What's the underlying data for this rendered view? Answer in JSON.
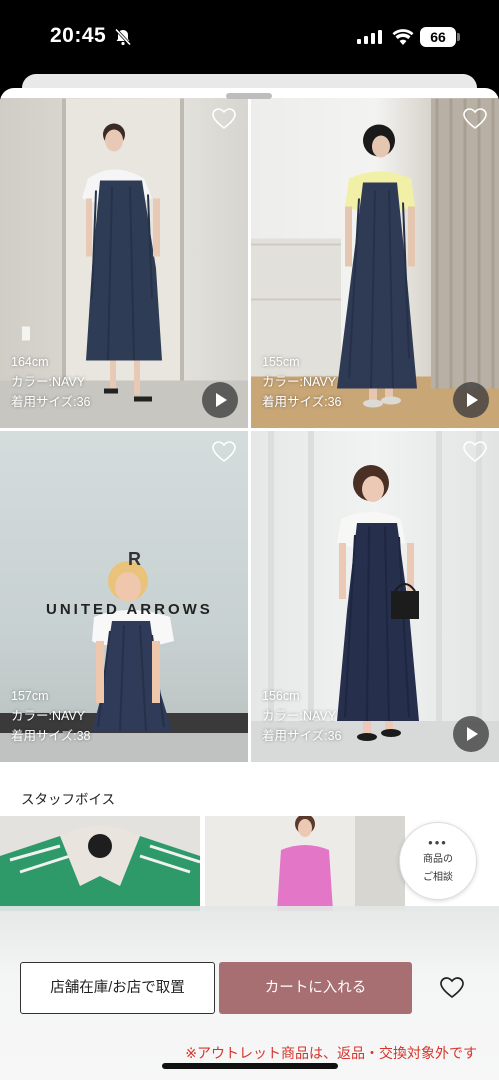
{
  "status_bar": {
    "time": "20:45",
    "battery": "66"
  },
  "looks": [
    {
      "height": "164cm",
      "color": "カラー:NAVY",
      "size": "着用サイズ:36",
      "has_play": true
    },
    {
      "height": "155cm",
      "color": "カラー:NAVY",
      "size": "着用サイズ:36",
      "has_play": true
    },
    {
      "height": "157cm",
      "color": "カラー:NAVY",
      "size": "着用サイズ:38",
      "has_play": false
    },
    {
      "height": "156cm",
      "color": "カラー:NAVY",
      "size": "着用サイズ:36",
      "has_play": true
    }
  ],
  "photo3_backdrop": {
    "brand_text": "UNITED ARROWS"
  },
  "staff_voice": {
    "title": "スタッフボイス",
    "consult_button": {
      "dots": "•••",
      "label_line1": "商品の",
      "label_line2": "ご相談"
    }
  },
  "footer": {
    "notice": "※アウトレット商品は、返品・交換対象外です",
    "store_button": "店舗在庫/お店で取置",
    "cart_button": "カートに入れる",
    "icons": {
      "favorite": "heart-outline-icon"
    },
    "colors": {
      "cart": "#a76f72",
      "notice": "#d5342c"
    }
  }
}
